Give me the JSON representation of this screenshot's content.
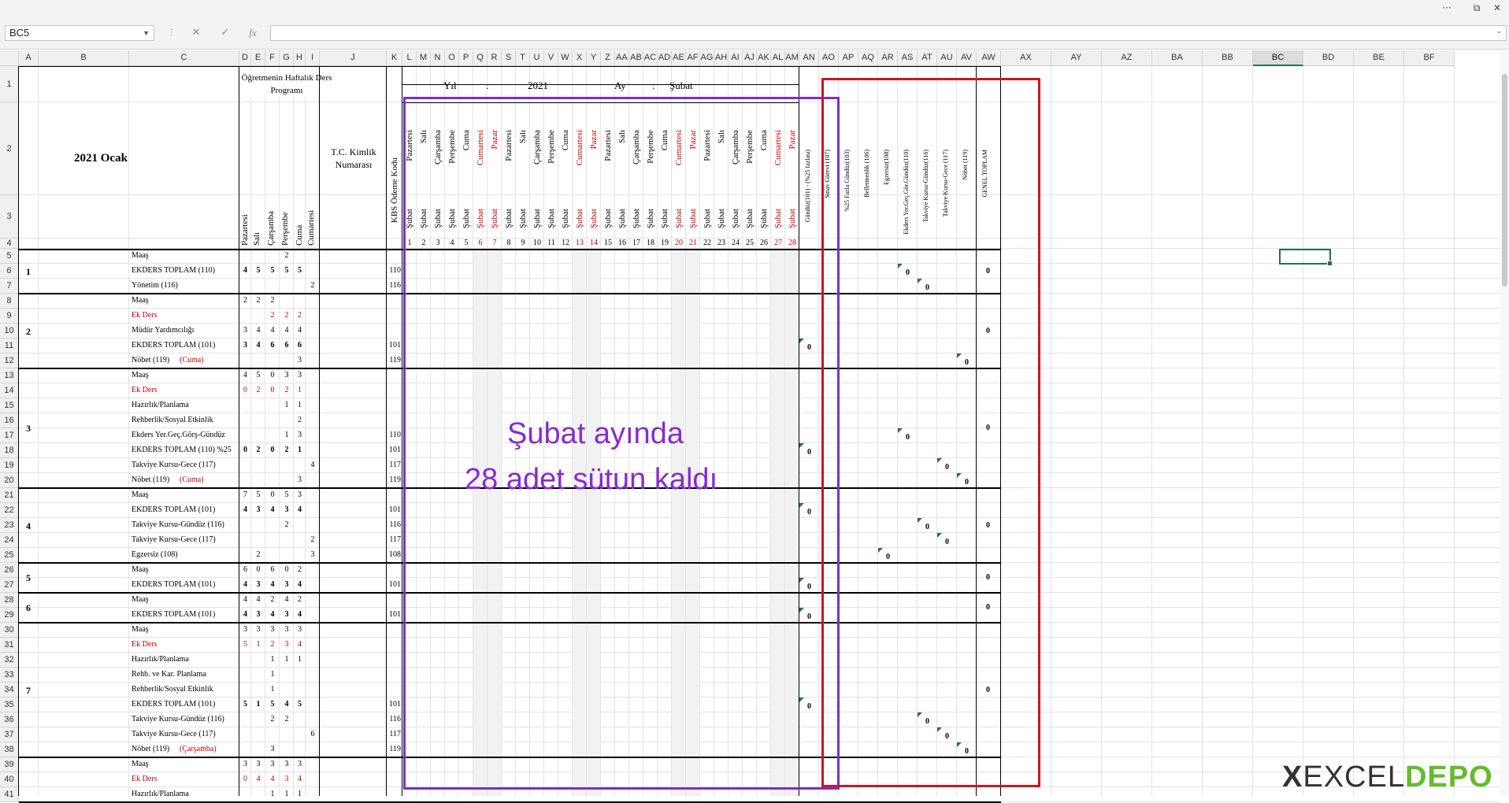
{
  "window": {
    "more_label": "···",
    "restore_label": "⧉",
    "close_label": "✕"
  },
  "formula_bar": {
    "name_box": "BC5",
    "fx_label": "fx",
    "cancel_label": "✕",
    "enter_label": "✓",
    "formula": ""
  },
  "columns": [
    "A",
    "B",
    "C",
    "D",
    "E",
    "F",
    "G",
    "H",
    "I",
    "J",
    "K",
    "L",
    "M",
    "N",
    "O",
    "P",
    "Q",
    "R",
    "S",
    "T",
    "U",
    "V",
    "W",
    "X",
    "Y",
    "Z",
    "AA",
    "AB",
    "AC",
    "AD",
    "AE",
    "AF",
    "AG",
    "AH",
    "AI",
    "AJ",
    "AK",
    "AL",
    "AM",
    "AN",
    "AO",
    "AP",
    "AQ",
    "AR",
    "AS",
    "AT",
    "AU",
    "AV",
    "AW",
    "AX",
    "AY",
    "AZ",
    "BA",
    "BB",
    "BC",
    "BD",
    "BE",
    "BF"
  ],
  "selected_column": "BC",
  "rows": [
    "1",
    "2",
    "3",
    "4",
    "5",
    "6",
    "7",
    "8",
    "9",
    "10",
    "11",
    "12",
    "13",
    "14",
    "15",
    "16",
    "17",
    "18",
    "19",
    "20",
    "21",
    "22",
    "23",
    "24",
    "25",
    "26",
    "27",
    "28",
    "29",
    "30",
    "31",
    "32",
    "33",
    "34",
    "35",
    "36",
    "37",
    "38",
    "39",
    "40",
    "41"
  ],
  "header": {
    "month_title": "2021 Ocak",
    "program_title": "Öğretmenin Haftalık Ders Programı",
    "weekdays": [
      "Pazartesi",
      "Salı",
      "Çarşamba",
      "Perşembe",
      "Cuma",
      "Cumartesi"
    ],
    "tc_label": "T.C. Kimlik Numarası",
    "kbs_label": "KBS Ödeme Kodu",
    "year_label": "Yıl",
    "colon": ":",
    "year_value": "2021",
    "month_label": "Ay",
    "month_value": "Şubat",
    "day_names": [
      "Pazartesi",
      "Salı",
      "Çarşamba",
      "Perşembe",
      "Cuma",
      "Cumartesi",
      "Pazar",
      "Pazartesi",
      "Salı",
      "Çarşamba",
      "Perşembe",
      "Cuma",
      "Cumartesi",
      "Pazar",
      "Pazartesi",
      "Salı",
      "Çarşamba",
      "Perşembe",
      "Cuma",
      "Cumartesi",
      "Pazar",
      "Pazartesi",
      "Salı",
      "Çarşamba",
      "Perşembe",
      "Cuma",
      "Cumartesi",
      "Pazar"
    ],
    "month_names": [
      "Şubat",
      "Şubat",
      "Şubat",
      "Şubat",
      "Şubat",
      "Şubat",
      "Şubat",
      "Şubat",
      "Şubat",
      "Şubat",
      "Şubat",
      "Şubat",
      "Şubat",
      "Şubat",
      "Şubat",
      "Şubat",
      "Şubat",
      "Şubat",
      "Şubat",
      "Şubat",
      "Şubat",
      "Şubat",
      "Şubat",
      "Şubat",
      "Şubat",
      "Şubat",
      "Şubat",
      "Şubat"
    ],
    "day_numbers": [
      "1",
      "2",
      "3",
      "4",
      "5",
      "6",
      "7",
      "8",
      "9",
      "10",
      "11",
      "12",
      "13",
      "14",
      "15",
      "16",
      "17",
      "18",
      "19",
      "20",
      "21",
      "22",
      "23",
      "24",
      "25",
      "26",
      "27",
      "28"
    ],
    "summary_headers": [
      "Gündüz(101) - (%25 fazlası)",
      "Sınav Görevi (107)",
      "%25 Fazla Gündüz(103)",
      "Belletmenlik (106)",
      "Egzersiz(108)",
      "Ekders Yer.Geç.Gör.Gündüz(110)",
      "Takviye Kursu-Gündüz(116)",
      "Takviye Kursu-Gece (117)",
      "Nöbet (119)",
      "GENEL TOPLAM"
    ]
  },
  "teachers": [
    {
      "no": "1",
      "total": "0",
      "lines": [
        {
          "label": "Maaş",
          "d": [
            "",
            "",
            "",
            "2",
            "",
            ""
          ],
          "code": ""
        },
        {
          "label": "EKDERS TOPLAM (110)",
          "d": [
            "4",
            "5",
            "5",
            "5",
            "5",
            ""
          ],
          "code": "110",
          "bold": true
        },
        {
          "label": "Yönetim (116)",
          "d": [
            "",
            "",
            "",
            "",
            "",
            "2"
          ],
          "code": "116"
        }
      ]
    },
    {
      "no": "2",
      "total": "0",
      "lines": [
        {
          "label": "Maaş",
          "d": [
            "2",
            "2",
            "2",
            "",
            "",
            ""
          ],
          "code": ""
        },
        {
          "label": "Ek Ders",
          "d": [
            "",
            "",
            "2",
            "2",
            "2",
            ""
          ],
          "code": "",
          "red": true
        },
        {
          "label": "Müdür Yardımcılığı",
          "d": [
            "3",
            "4",
            "4",
            "4",
            "4",
            ""
          ],
          "code": ""
        },
        {
          "label": "EKDERS TOPLAM (101)",
          "d": [
            "3",
            "4",
            "6",
            "6",
            "6",
            ""
          ],
          "code": "101",
          "bold": true
        },
        {
          "label": "Nöbet (119)",
          "suffix": "(Cuma)",
          "d": [
            "",
            "",
            "",
            "",
            "3",
            ""
          ],
          "code": "119"
        }
      ]
    },
    {
      "no": "3",
      "total": "0",
      "lines": [
        {
          "label": "Maaş",
          "d": [
            "4",
            "5",
            "0",
            "3",
            "3",
            ""
          ],
          "code": ""
        },
        {
          "label": "Ek Ders",
          "d": [
            "0",
            "2",
            "0",
            "2",
            "1",
            ""
          ],
          "code": "",
          "red": true
        },
        {
          "label": "Hazırlık/Planlama",
          "d": [
            "",
            "",
            "",
            "1",
            "1",
            ""
          ],
          "code": ""
        },
        {
          "label": "Rehberlik/Sosyal Etkinlik",
          "d": [
            "",
            "",
            "",
            "",
            "2",
            ""
          ],
          "code": ""
        },
        {
          "label": "Ekders Yer.Geç.Görş-Gündüz",
          "d": [
            "",
            "",
            "",
            "1",
            "3",
            ""
          ],
          "code": "110"
        },
        {
          "label": "EKDERS TOPLAM (110) %25",
          "d": [
            "0",
            "2",
            "0",
            "2",
            "1",
            ""
          ],
          "code": "101",
          "bold": true
        },
        {
          "label": "Takviye Kursu-Gece (117)",
          "d": [
            "",
            "",
            "",
            "",
            "",
            "4"
          ],
          "code": "117"
        },
        {
          "label": "Nöbet (119)",
          "suffix": "(Cuma)",
          "d": [
            "",
            "",
            "",
            "",
            "3",
            ""
          ],
          "code": "119"
        }
      ]
    },
    {
      "no": "4",
      "total": "0",
      "lines": [
        {
          "label": "Maaş",
          "d": [
            "7",
            "5",
            "0",
            "5",
            "3",
            ""
          ],
          "code": ""
        },
        {
          "label": "EKDERS TOPLAM (101)",
          "d": [
            "4",
            "3",
            "4",
            "3",
            "4",
            ""
          ],
          "code": "101",
          "bold": true
        },
        {
          "label": "Takviye Kursu-Gündüz (116)",
          "d": [
            "",
            "",
            "",
            "2",
            "",
            ""
          ],
          "code": "116"
        },
        {
          "label": "Takviye Kursu-Gece (117)",
          "d": [
            "",
            "",
            "",
            "",
            "",
            "2"
          ],
          "code": "117"
        },
        {
          "label": "Egzersiz (108)",
          "d": [
            "",
            "2",
            "",
            "",
            "",
            "3"
          ],
          "code": "108"
        }
      ]
    },
    {
      "no": "5",
      "total": "0",
      "lines": [
        {
          "label": "Maaş",
          "d": [
            "6",
            "0",
            "6",
            "0",
            "2",
            ""
          ],
          "code": ""
        },
        {
          "label": "EKDERS TOPLAM (101)",
          "d": [
            "4",
            "3",
            "4",
            "3",
            "4",
            ""
          ],
          "code": "101",
          "bold": true
        }
      ]
    },
    {
      "no": "6",
      "total": "0",
      "lines": [
        {
          "label": "Maaş",
          "d": [
            "4",
            "4",
            "2",
            "4",
            "2",
            ""
          ],
          "code": ""
        },
        {
          "label": "EKDERS TOPLAM (101)",
          "d": [
            "4",
            "3",
            "4",
            "3",
            "4",
            ""
          ],
          "code": "101",
          "bold": true
        }
      ]
    },
    {
      "no": "7",
      "total": "0",
      "lines": [
        {
          "label": "Maaş",
          "d": [
            "3",
            "3",
            "3",
            "3",
            "3",
            ""
          ],
          "code": ""
        },
        {
          "label": "Ek Ders",
          "d": [
            "5",
            "1",
            "2",
            "3",
            "4",
            ""
          ],
          "code": "",
          "red": true
        },
        {
          "label": "Hazırlık/Planlama",
          "d": [
            "",
            "",
            "1",
            "1",
            "1",
            ""
          ],
          "code": ""
        },
        {
          "label": "Rehb. ve Kar. Planlama",
          "d": [
            "",
            "",
            "1",
            "",
            "",
            ""
          ],
          "code": ""
        },
        {
          "label": "Rehberlik/Sosyal Etkinlik",
          "d": [
            "",
            "",
            "1",
            "",
            "",
            ""
          ],
          "code": ""
        },
        {
          "label": "EKDERS TOPLAM (101)",
          "d": [
            "5",
            "1",
            "5",
            "4",
            "5",
            ""
          ],
          "code": "101",
          "bold": true
        },
        {
          "label": "Takviye Kursu-Gündüz (116)",
          "d": [
            "",
            "",
            "2",
            "2",
            "",
            ""
          ],
          "code": "116"
        },
        {
          "label": "Takviye Kursu-Gece (117)",
          "d": [
            "",
            "",
            "",
            "",
            "",
            "6"
          ],
          "code": "117"
        },
        {
          "label": "Nöbet (119)",
          "suffix": "(Çarşamba)",
          "d": [
            "",
            "",
            "3",
            "",
            "",
            ""
          ],
          "code": "119"
        }
      ]
    },
    {
      "no": "",
      "total": "",
      "lines": [
        {
          "label": "Maaş",
          "d": [
            "3",
            "3",
            "3",
            "3",
            "3",
            ""
          ],
          "code": ""
        },
        {
          "label": "Ek Ders",
          "d": [
            "0",
            "4",
            "4",
            "3",
            "4",
            ""
          ],
          "code": "",
          "red": true
        },
        {
          "label": "Hazırlık/Planlama",
          "d": [
            "",
            "",
            "1",
            "1",
            "1",
            ""
          ],
          "code": ""
        }
      ]
    }
  ],
  "row_zero_value": "0",
  "annotation": {
    "line1": "Şubat ayında",
    "line2": "28 adet sütun kaldı"
  },
  "logo": {
    "prefix": "X",
    "text1": "EXCEL",
    "text2": "DEPO"
  }
}
